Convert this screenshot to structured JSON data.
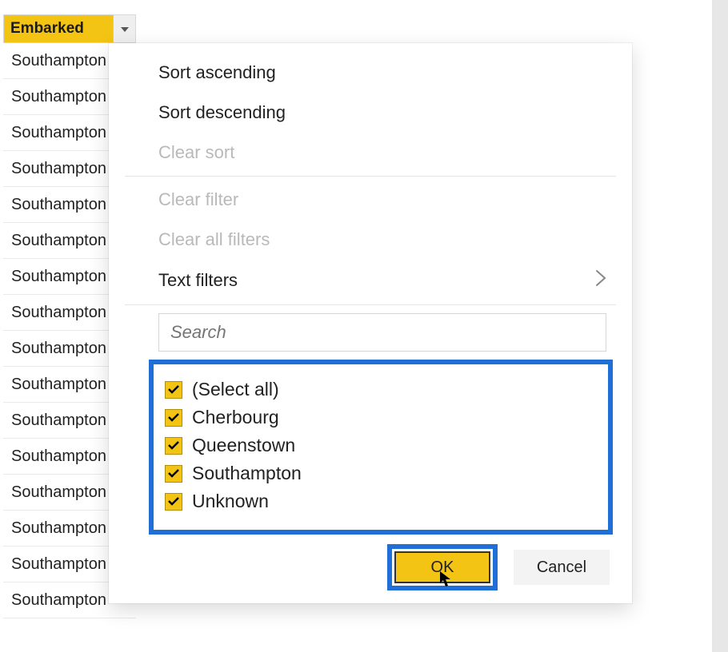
{
  "column": {
    "header": "Embarked",
    "cells": [
      "Southampton",
      "Southampton",
      "Southampton",
      "Southampton",
      "Southampton",
      "Southampton",
      "Southampton",
      "Southampton",
      "Southampton",
      "Southampton",
      "Southampton",
      "Southampton",
      "Southampton",
      "Southampton",
      "Southampton",
      "Southampton"
    ]
  },
  "menu": {
    "sortAsc": "Sort ascending",
    "sortDesc": "Sort descending",
    "clearSort": "Clear sort",
    "clearFilter": "Clear filter",
    "clearAllFilters": "Clear all filters",
    "textFilters": "Text filters",
    "searchPlaceholder": "Search",
    "values": {
      "selectAll": "(Select all)",
      "items": [
        "Cherbourg",
        "Queenstown",
        "Southampton",
        "Unknown"
      ]
    },
    "ok": "OK",
    "cancel": "Cancel"
  }
}
